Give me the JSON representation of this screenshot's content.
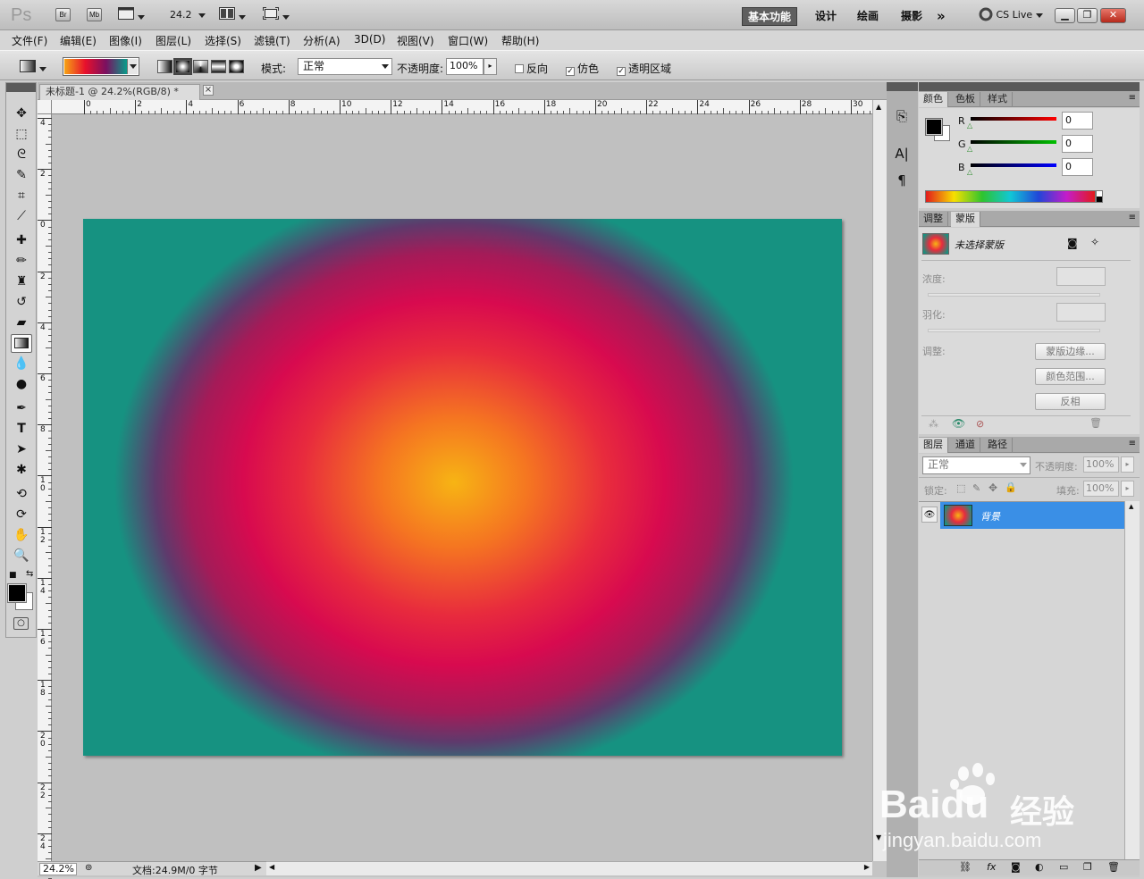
{
  "app": {
    "logo": "Ps",
    "bridge": "Br",
    "mini_bridge": "Mb",
    "zoom_display": "24.2"
  },
  "workspaces": [
    "基本功能",
    "设计",
    "绘画",
    "摄影"
  ],
  "more_icon": "»",
  "cs_live": "CS Live",
  "menus": [
    "文件(F)",
    "编辑(E)",
    "图像(I)",
    "图层(L)",
    "选择(S)",
    "滤镜(T)",
    "分析(A)",
    "3D(D)",
    "视图(V)",
    "窗口(W)",
    "帮助(H)"
  ],
  "options": {
    "mode_label": "模式:",
    "mode_value": "正常",
    "opacity_label": "不透明度:",
    "opacity_value": "100%",
    "reverse": "反向",
    "dither": "仿色",
    "transparency": "透明区域",
    "reverse_checked": false,
    "dither_checked": true,
    "transparency_checked": true
  },
  "document": {
    "tab_title": "未标题-1 @ 24.2%(RGB/8) *",
    "close": "×",
    "zoom": "24.2%",
    "doc_info": "文档:24.9M/0 字节",
    "ruler_h": [
      "0",
      "2",
      "4",
      "6",
      "8",
      "10",
      "12",
      "14",
      "16",
      "18",
      "20",
      "22",
      "24",
      "26",
      "28",
      "30"
    ],
    "ruler_v": [
      "4",
      "2",
      "0",
      "2",
      "4",
      "6",
      "8",
      "1\n0",
      "1\n2",
      "1\n4",
      "1\n6",
      "1\n8",
      "2\n0",
      "2\n2",
      "2\n4"
    ]
  },
  "color_panel": {
    "tabs": [
      "颜色",
      "色板",
      "样式"
    ],
    "channels": [
      {
        "label": "R",
        "value": "0",
        "color": "#ff0000"
      },
      {
        "label": "G",
        "value": "0",
        "color": "#00c000"
      },
      {
        "label": "B",
        "value": "0",
        "color": "#0000ff"
      }
    ]
  },
  "masks_panel": {
    "tabs": [
      "调整",
      "蒙版"
    ],
    "title": "未选择蒙版",
    "density": "浓度:",
    "feather": "羽化:",
    "adjust": "调整:",
    "mask_edge": "蒙版边缘...",
    "color_range": "颜色范围...",
    "invert": "反相"
  },
  "layers_panel": {
    "tabs": [
      "图层",
      "通道",
      "路径"
    ],
    "blend": "正常",
    "opacity_label": "不透明度:",
    "opacity_value": "100%",
    "lock_label": "锁定:",
    "fill_label": "填充:",
    "fill_value": "100%",
    "layers": [
      {
        "name": "背景",
        "locked": true,
        "visible": true
      }
    ]
  },
  "watermark": {
    "brand": "Baidu",
    "cn": "经验",
    "url": "jingyan.baidu.com"
  }
}
